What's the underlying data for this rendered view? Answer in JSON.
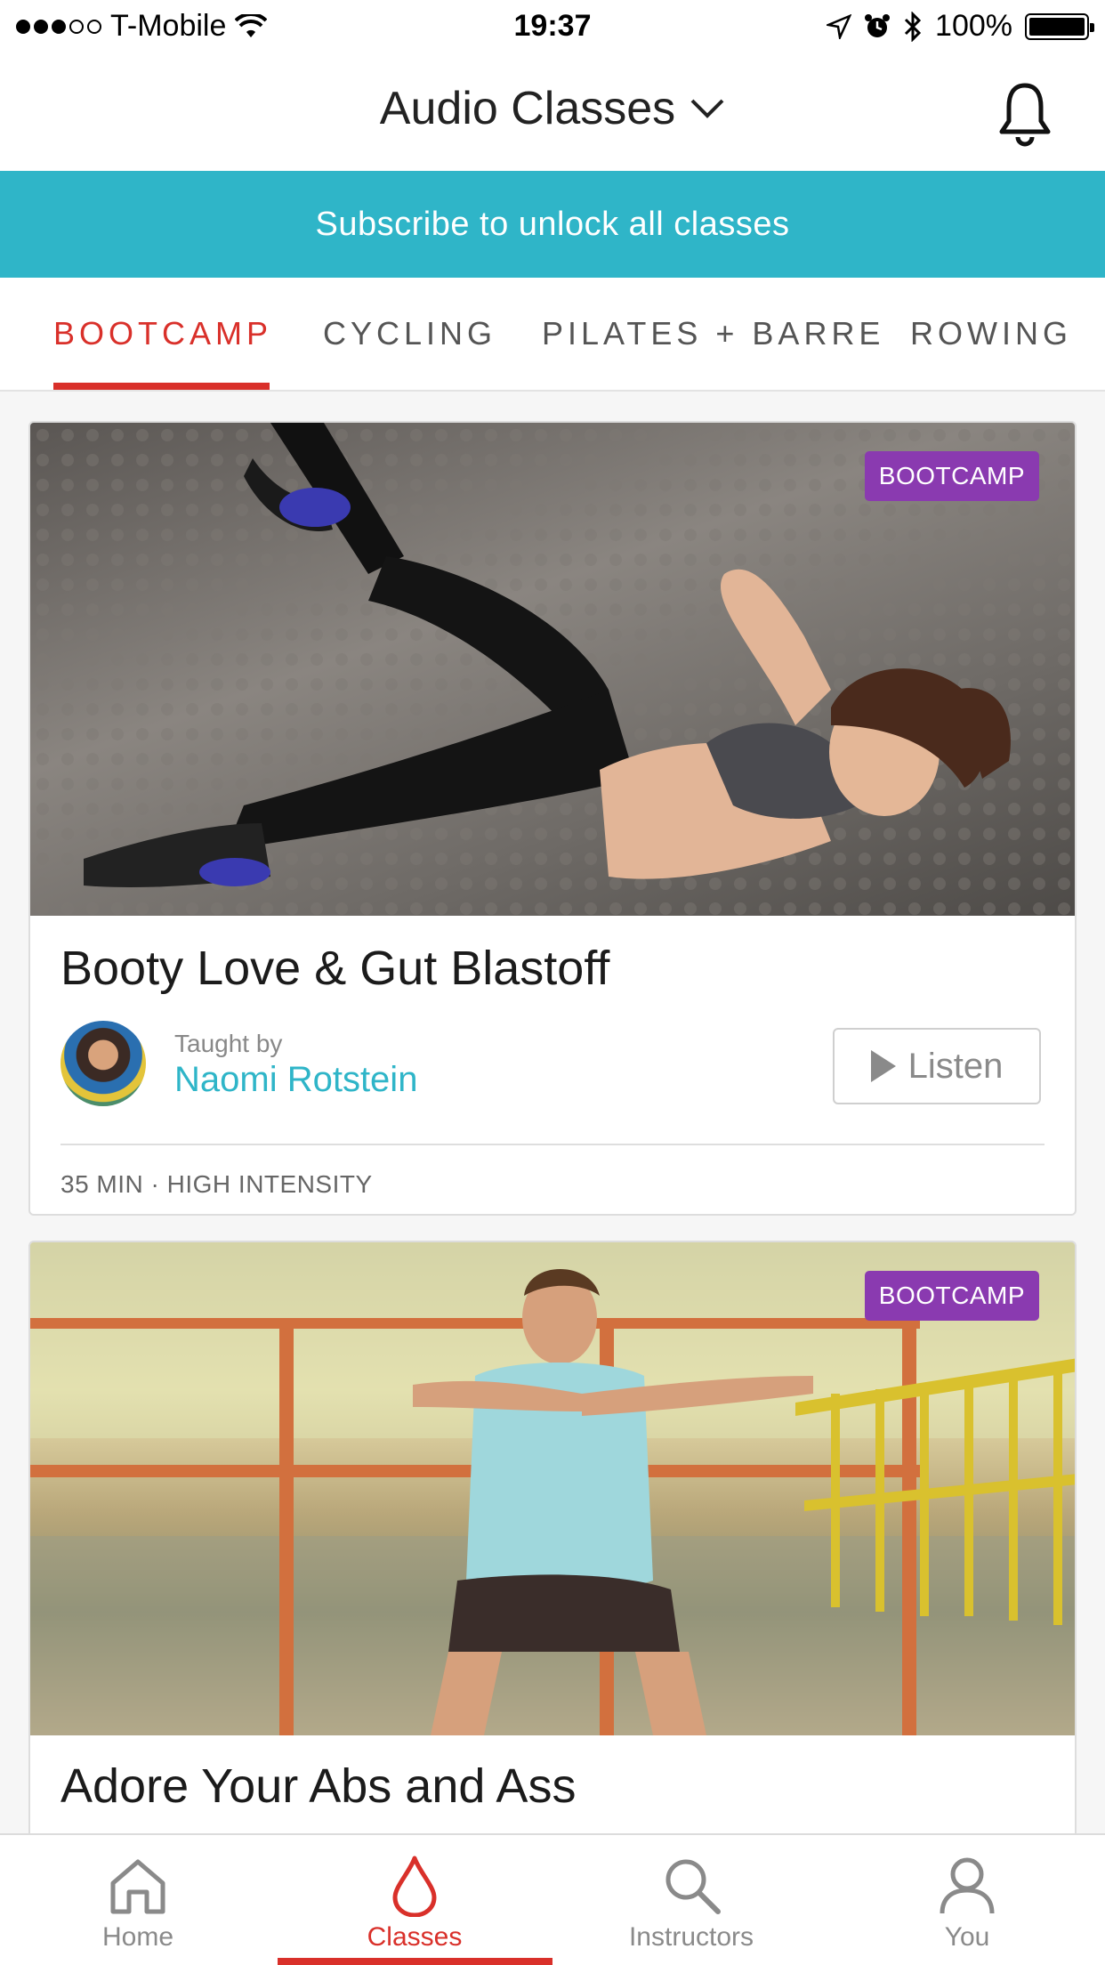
{
  "status_bar": {
    "carrier": "T-Mobile",
    "time": "19:37",
    "battery": "100%"
  },
  "header": {
    "title": "Audio Classes"
  },
  "banner": {
    "text": "Subscribe to unlock all classes"
  },
  "category_tabs": [
    {
      "label": "BOOTCAMP",
      "active": true
    },
    {
      "label": "CYCLING",
      "active": false
    },
    {
      "label": "PILATES + BARRE",
      "active": false
    },
    {
      "label": "ROWING",
      "active": false
    }
  ],
  "classes": [
    {
      "badge": "BOOTCAMP",
      "title": "Booty Love & Gut Blastoff",
      "taught_by": "Taught by",
      "instructor": "Naomi Rotstein",
      "listen_label": "Listen",
      "meta": "35 MIN · HIGH INTENSITY"
    },
    {
      "badge": "BOOTCAMP",
      "title": "Adore Your Abs and Ass"
    }
  ],
  "tabbar": [
    {
      "label": "Home",
      "icon": "home-icon",
      "active": false
    },
    {
      "label": "Classes",
      "icon": "drop-icon",
      "active": true
    },
    {
      "label": "Instructors",
      "icon": "search-icon",
      "active": false
    },
    {
      "label": "You",
      "icon": "person-icon",
      "active": false
    }
  ],
  "colors": {
    "accent_red": "#d9302a",
    "teal": "#2fb5c8",
    "badge_purple": "#8a3ab0"
  }
}
